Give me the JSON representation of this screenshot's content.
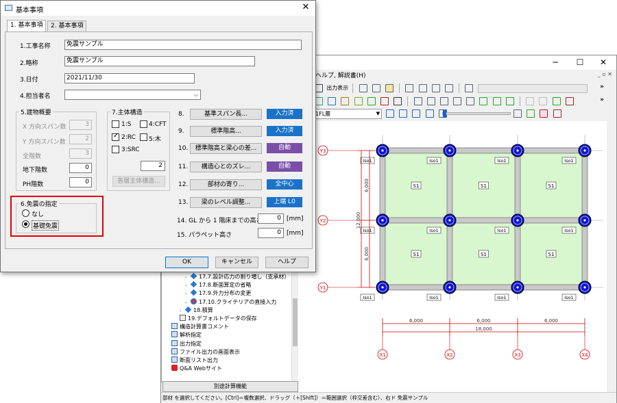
{
  "app": {
    "menu_visible": "ヘルプ, 解説書(H)",
    "window_controls": {
      "minimize": "─",
      "maximize": "☐",
      "close": "✕"
    },
    "menu_right_controls": "_ ▫ ✕",
    "toolbar": {
      "output_display": "出力表示"
    },
    "layer_combo": "1FL層",
    "tree_items": [
      {
        "label": "17.7.設計応力の割り増し（支承材）",
        "icon": "diamond-icon"
      },
      {
        "label": "17.8.断面算定の省略",
        "icon": "diamond-icon"
      },
      {
        "label": "17.9.外力分布の変更",
        "icon": "diamond-icon"
      },
      {
        "label": "17.10.クライテリアの直接入力",
        "icon": "target-icon"
      },
      {
        "label": "18.積算",
        "icon": "diamond-icon"
      },
      {
        "label": "19.デフォルトデータの保存",
        "icon": "grid-icon"
      },
      {
        "label": "構造計算書コメント",
        "icon": "doc-icon"
      },
      {
        "label": "解析指定",
        "icon": "doc-icon"
      },
      {
        "label": "出力指定",
        "icon": "doc-icon"
      },
      {
        "label": "ファイル出力の画面表示",
        "icon": "doc-icon"
      },
      {
        "label": "断面リスト出力",
        "icon": "doc-icon"
      },
      {
        "label": "Q&A Webサイト",
        "icon": "qa-icon"
      }
    ],
    "separate_calc_button": "別途計算機能",
    "status_text": "部材 を選択してください。[Ctrl]＝複数選択、ドラッグ（＋[Shift]）＝範囲選択（枠交差含む）、右ド 免震サンプル"
  },
  "plan": {
    "x_axes": [
      "X1",
      "X2",
      "X3",
      "X4"
    ],
    "y_axes": [
      "Y1",
      "Y2",
      "Y3"
    ],
    "x_spans": [
      "6,000",
      "6,000",
      "6,000"
    ],
    "x_total": "18,000",
    "y_spans": [
      "6,000",
      "6,000"
    ],
    "y_total": "12,000",
    "slab_label": "S1",
    "isolator_label": "Iso1",
    "colors": {
      "slab": "#d9f7cf",
      "beam": "#c9c9c9",
      "column": "#1414c8",
      "dim": "#d00000"
    }
  },
  "dialog": {
    "title": "基本事項",
    "close": "✕",
    "tabs": [
      "1. 基本事項",
      "2. 基本事項"
    ],
    "project_name_label": "1.工事名称",
    "project_name_value": "免震サンプル",
    "abbrev_label": "2.略称",
    "abbrev_value": "免震サンプル",
    "date_label": "3.日付",
    "date_value": "2021/11/30",
    "person_label": "4.担当者名",
    "person_value": "",
    "building_group": {
      "title": "5.建物概要",
      "x_spans_label": "X 方向スパン数",
      "x_spans_value": "3",
      "y_spans_label": "Y 方向スパン数",
      "y_spans_value": "2",
      "floors_label": "全階数",
      "floors_value": "3",
      "basement_label": "地下階数",
      "basement_value": "0",
      "ph_label": "PH階数",
      "ph_value": "0"
    },
    "structure_group": {
      "title": "7.主体構造",
      "options": [
        {
          "label": "1:S",
          "checked": false
        },
        {
          "label": "4:CFT",
          "checked": false
        },
        {
          "label": "2:RC",
          "checked": true
        },
        {
          "label": "5:木",
          "checked": false
        },
        {
          "label": "3:SRC",
          "checked": false
        }
      ],
      "value": "2",
      "per_floor_button": "各層主体構造..."
    },
    "isolation_group": {
      "title": "6.免震の指定",
      "options": [
        {
          "label": "なし",
          "selected": false
        },
        {
          "label": "基礎免震",
          "selected": true
        }
      ]
    },
    "settings": [
      {
        "num": "8.",
        "button": "基準スパン長...",
        "status": "入力済",
        "color": "#1a73c8"
      },
      {
        "num": "9.",
        "button": "標準階高...",
        "status": "入力済",
        "color": "#1a73c8"
      },
      {
        "num": "10.",
        "button": "標準階高と梁心の差...",
        "status": "自動",
        "color": "#7a4fa8"
      },
      {
        "num": "11.",
        "button": "構造心とのズレ...",
        "status": "自動",
        "color": "#7a4fa8"
      },
      {
        "num": "12.",
        "button": "部材の寄り...",
        "status": "全中心",
        "color": "#1a73c8"
      },
      {
        "num": "13.",
        "button": "梁のレベル調整...",
        "status": "上端 L0",
        "color": "#1a73c8"
      }
    ],
    "gl_label": "14. GL から 1 階床までの高さ",
    "gl_value": "0",
    "gl_unit": "[mm]",
    "parapet_label": "15. パラペット高さ",
    "parapet_value": "0",
    "parapet_unit": "[mm]",
    "ok": "OK",
    "cancel": "キャンセル",
    "help": "ヘルプ"
  }
}
